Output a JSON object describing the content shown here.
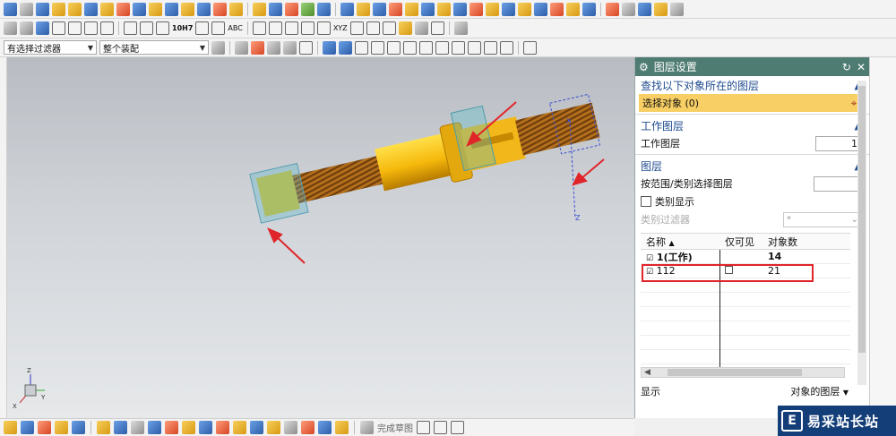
{
  "toolbar": {
    "filter_select": "有选择过滤器",
    "assembly_select": "整个装配",
    "icon_label_1": "10H7",
    "icon_label_2": "ABC",
    "icon_label_3": "XYZ"
  },
  "bottom_toolbar": {
    "finish_sketch": "完成草图"
  },
  "panel": {
    "title": "图层设置",
    "find_section": "查找以下对象所在的图层",
    "select_object": "选择对象 (0)",
    "work_section": "工作图层",
    "work_layer_label": "工作图层",
    "work_layer_value": "1",
    "layer_section": "图层",
    "range_label": "按范围/类别选择图层",
    "category_display": "类别显示",
    "category_filter_label": "类别过滤器",
    "category_filter_value": "*",
    "table": {
      "headers": [
        "名称",
        "仅可见",
        "对象数"
      ],
      "rows": [
        {
          "name": "1(工作)",
          "visible": "",
          "count": "14"
        },
        {
          "name": "112",
          "visible": "",
          "count": "21"
        }
      ]
    },
    "footer_label": "显示",
    "footer_value": "对象的图层"
  },
  "viewport": {
    "axes": [
      "X",
      "Y",
      "Z"
    ]
  },
  "watermark": {
    "logo": "E",
    "name": "易采站长站"
  },
  "colors": {
    "accent": "#4e7b72",
    "highlight": "#f7cf64",
    "annotation": "#e0252a"
  }
}
